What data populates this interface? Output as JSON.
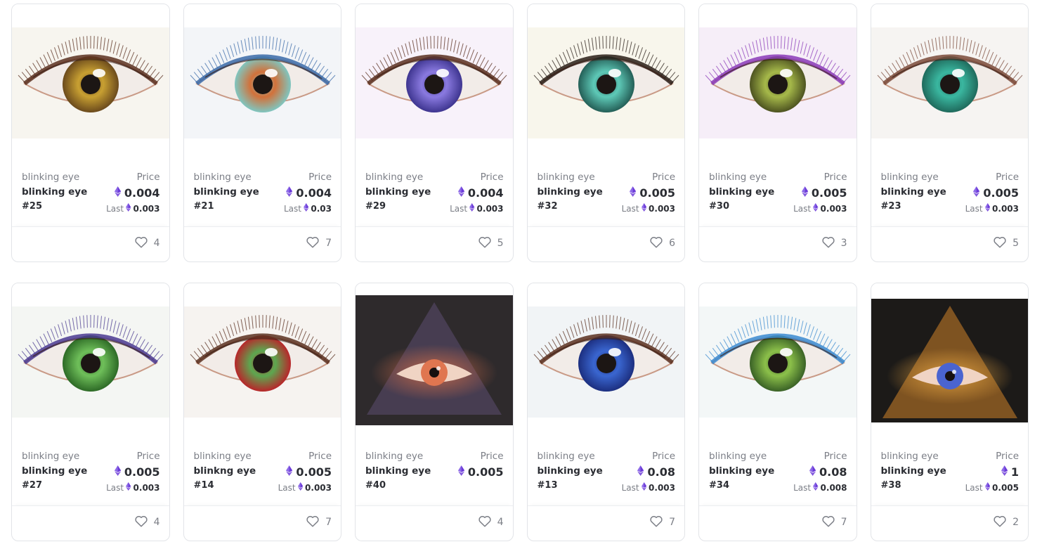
{
  "labels": {
    "price": "Price",
    "last": "Last"
  },
  "colors": {
    "eth": "#6c3bd8",
    "border": "#e2e4e8",
    "muted": "#7b7e86"
  },
  "cards": [
    {
      "collection": "blinking eye",
      "name": "blinking eye",
      "token": "#25",
      "price": "0.004",
      "last": "0.003",
      "likes": "4",
      "art": {
        "kind": "eye",
        "bg": "#f7f5ef",
        "iris": "#c8a032",
        "iris2": "#6b4a1c",
        "lash": "#5a3020"
      }
    },
    {
      "collection": "blinking eye",
      "name": "blinking eye",
      "token": "#21",
      "price": "0.004",
      "last": "0.03",
      "likes": "7",
      "art": {
        "kind": "eye",
        "bg": "#f3f5f8",
        "iris": "#d2713a",
        "iris2": "#7fc6c0",
        "lash": "#3a6aa8"
      }
    },
    {
      "collection": "blinking eye",
      "name": "blinking eye",
      "token": "#29",
      "price": "0.004",
      "last": "0.003",
      "likes": "5",
      "art": {
        "kind": "eye",
        "bg": "#f8f2fa",
        "iris": "#8a7ae0",
        "iris2": "#3e3590",
        "lash": "#5a3020"
      }
    },
    {
      "collection": "blinking eye",
      "name": "blinking eye",
      "token": "#32",
      "price": "0.005",
      "last": "0.003",
      "likes": "6",
      "art": {
        "kind": "eye",
        "bg": "#f8f6ec",
        "iris": "#5ec9b7",
        "iris2": "#245f57",
        "lash": "#2a1e18"
      }
    },
    {
      "collection": "blinking eye",
      "name": "blinking eye",
      "token": "#30",
      "price": "0.005",
      "last": "0.003",
      "likes": "3",
      "art": {
        "kind": "eye",
        "bg": "#f6eef8",
        "iris": "#a6b94a",
        "iris2": "#4d5320",
        "lash": "#8a3ab8"
      }
    },
    {
      "collection": "blinking eye",
      "name": "blinking eye",
      "token": "#23",
      "price": "0.005",
      "last": "0.003",
      "likes": "5",
      "art": {
        "kind": "eye",
        "bg": "#f6f4f2",
        "iris": "#3ab7a0",
        "iris2": "#1f6a5c",
        "lash": "#7a4a3a"
      }
    },
    {
      "collection": "blinking eye",
      "name": "blinking eye",
      "token": "#27",
      "price": "0.005",
      "last": "0.003",
      "likes": "4",
      "art": {
        "kind": "eye",
        "bg": "#f4f6f3",
        "iris": "#6fbf5a",
        "iris2": "#2d6a26",
        "lash": "#4a3a90"
      }
    },
    {
      "collection": "blinking eye",
      "name": "blinkng eye",
      "token": "#14",
      "price": "0.005",
      "last": "0.003",
      "likes": "7",
      "art": {
        "kind": "eye",
        "bg": "#f6f3f0",
        "iris": "#5ca850",
        "iris2": "#b8262a",
        "lash": "#5a3020"
      }
    },
    {
      "collection": "blinking eye",
      "name": "blinking eye",
      "token": "#40",
      "price": "0.005",
      "last": "",
      "likes": "4",
      "art": {
        "kind": "pyramid",
        "bg": "#2e2a2c",
        "tri": "#4a3f55",
        "iris": "#e07650",
        "iris2": "#5a2a1c",
        "glow": "#c86a4a"
      }
    },
    {
      "collection": "blinking eye",
      "name": "blinking eye",
      "token": "#13",
      "price": "0.08",
      "last": "0.003",
      "likes": "7",
      "art": {
        "kind": "eye",
        "bg": "#f1f4f6",
        "iris": "#3a66d0",
        "iris2": "#1c2f80",
        "lash": "#5a3020"
      }
    },
    {
      "collection": "blinking eye",
      "name": "blinking eye",
      "token": "#34",
      "price": "0.08",
      "last": "0.008",
      "likes": "7",
      "art": {
        "kind": "eye",
        "bg": "#f3f7f7",
        "iris": "#8cc04a",
        "iris2": "#3a6226",
        "lash": "#3a8ad0"
      }
    },
    {
      "collection": "blinking eye",
      "name": "blinking eye",
      "token": "#38",
      "price": "1",
      "last": "0.005",
      "likes": "2",
      "art": {
        "kind": "pyramid",
        "bg": "#1c1a18",
        "tri": "#8a5a22",
        "iris": "#4a64d0",
        "iris2": "#1a2a70",
        "glow": "#e0a040"
      }
    }
  ]
}
